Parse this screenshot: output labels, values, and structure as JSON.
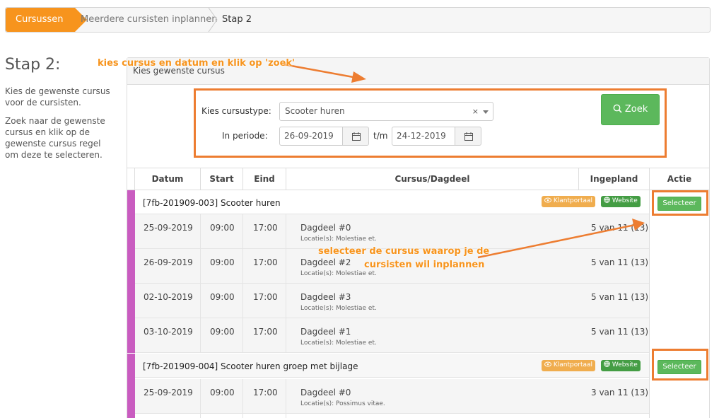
{
  "breadcrumb": [
    "Cursussen",
    "Meerdere cursisten inplannen",
    "Stap 2"
  ],
  "sidebar": {
    "title": "Stap 2:",
    "text1": "Kies de gewenste cursus voor de cursisten.",
    "text2": "Zoek naar de gewenste cursus en klik op de gewenste cursus regel om deze te selecteren."
  },
  "panel": {
    "heading": "Kies gewenste cursus"
  },
  "filter": {
    "type_label": "Kies cursustype:",
    "type_value": "Scooter huren",
    "clear": "×",
    "period_label": "In periode:",
    "date_from": "26-09-2019",
    "tm": "t/m",
    "date_to": "24-12-2019",
    "search_button": "Zoek"
  },
  "table": {
    "headers": [
      "Datum",
      "Start",
      "Eind",
      "Cursus/Dagdeel",
      "Ingepland",
      "Actie"
    ],
    "groups": [
      {
        "title": "[7fb-201909-003] Scooter huren",
        "badge1": "Klantportaal",
        "badge2": "Website",
        "select": "Selecteer",
        "rows": [
          {
            "date": "25-09-2019",
            "start": "09:00",
            "end": "17:00",
            "part": "Dagdeel #0",
            "loc": "Locatie(s): Molestiae et.",
            "planned": "5 van 11 (13)"
          },
          {
            "date": "26-09-2019",
            "start": "09:00",
            "end": "17:00",
            "part": "Dagdeel #2",
            "loc": "Locatie(s): Molestiae et.",
            "planned": "5 van 11 (13)"
          },
          {
            "date": "02-10-2019",
            "start": "09:00",
            "end": "17:00",
            "part": "Dagdeel #3",
            "loc": "Locatie(s): Molestiae et.",
            "planned": "5 van 11 (13)"
          },
          {
            "date": "03-10-2019",
            "start": "09:00",
            "end": "17:00",
            "part": "Dagdeel #1",
            "loc": "Locatie(s): Molestiae et.",
            "planned": "5 van 11 (13)"
          }
        ]
      },
      {
        "title": "[7fb-201909-004] Scooter huren groep met bijlage",
        "badge1": "Klantportaal",
        "badge2": "Website",
        "select": "Selecteer",
        "rows": [
          {
            "date": "25-09-2019",
            "start": "09:00",
            "end": "17:00",
            "part": "Dagdeel #0",
            "loc": "Locatie(s): Possimus vitae.",
            "planned": "3 van 11 (13)"
          }
        ]
      }
    ]
  },
  "annotations": {
    "top": "kies cursus en datum en klik op 'zoek'",
    "mid_line1": "selecteer de cursus waarop je de",
    "mid_line2": "cursisten wil inplannen"
  },
  "colors": {
    "accent": "#f7941d",
    "annotation_box": "#ed7d31",
    "success": "#5cb85c",
    "group_bar": "#c95cc0"
  }
}
